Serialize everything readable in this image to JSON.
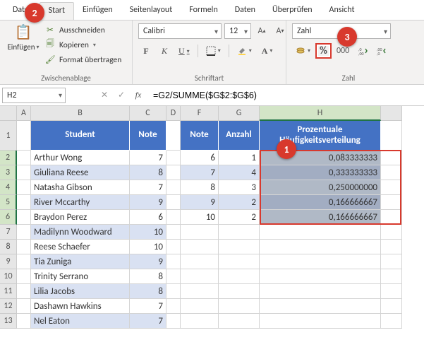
{
  "tabs": {
    "file": "Datei",
    "start": "Start",
    "insert": "Einfügen",
    "layout": "Seitenlayout",
    "formulas": "Formeln",
    "data": "Daten",
    "review": "Überprüfen",
    "view": "Ansicht"
  },
  "clipboard": {
    "paste": "Einfügen",
    "cut": "Ausschneiden",
    "copy": "Kopieren",
    "painter": "Format übertragen",
    "group": "Zwischenablage"
  },
  "font": {
    "name": "Calibri",
    "size": "12",
    "group": "Schriftart",
    "bold": "F",
    "italic": "K",
    "underline": "U"
  },
  "number": {
    "format": "Zahl",
    "group": "Zahl"
  },
  "namebox": "H2",
  "formula": "=G2/SUMME($G$2:$G$6)",
  "cols": [
    "A",
    "B",
    "C",
    "D",
    "F",
    "G",
    "H"
  ],
  "rownums": [
    "1",
    "2",
    "3",
    "4",
    "5",
    "6",
    "7",
    "8",
    "9",
    "10",
    "11",
    "12",
    "13"
  ],
  "table1": {
    "hStudent": "Student",
    "hNote": "Note",
    "rows": [
      {
        "student": "Arthur Wong",
        "note": "7"
      },
      {
        "student": "Giuliana Reese",
        "note": "8"
      },
      {
        "student": "Natasha Gibson",
        "note": "7"
      },
      {
        "student": "River Mccarthy",
        "note": "9"
      },
      {
        "student": "Braydon Perez",
        "note": "6"
      },
      {
        "student": "Madilynn Woodward",
        "note": "10"
      },
      {
        "student": "Reese Schaefer",
        "note": "10"
      },
      {
        "student": "Tia Zuniga",
        "note": "9"
      },
      {
        "student": "Trinity Serrano",
        "note": "8"
      },
      {
        "student": "Lilia Jacobs",
        "note": "8"
      },
      {
        "student": "Dashawn Hawkins",
        "note": "7"
      },
      {
        "student": "Nel Eaton",
        "note": "7"
      }
    ]
  },
  "table2": {
    "hNote": "Note",
    "hAnzahl": "Anzahl",
    "hProz": "Prozentuale Häufigkeitsverteilung",
    "rows": [
      {
        "note": "6",
        "anzahl": "1",
        "proz": "0,083333333"
      },
      {
        "note": "7",
        "anzahl": "4",
        "proz": "0,333333333"
      },
      {
        "note": "8",
        "anzahl": "3",
        "proz": "0,250000000"
      },
      {
        "note": "9",
        "anzahl": "2",
        "proz": "0,166666667"
      },
      {
        "note": "10",
        "anzahl": "2",
        "proz": "0,166666667"
      }
    ]
  },
  "callouts": {
    "c1": "1",
    "c2": "2",
    "c3": "3"
  }
}
